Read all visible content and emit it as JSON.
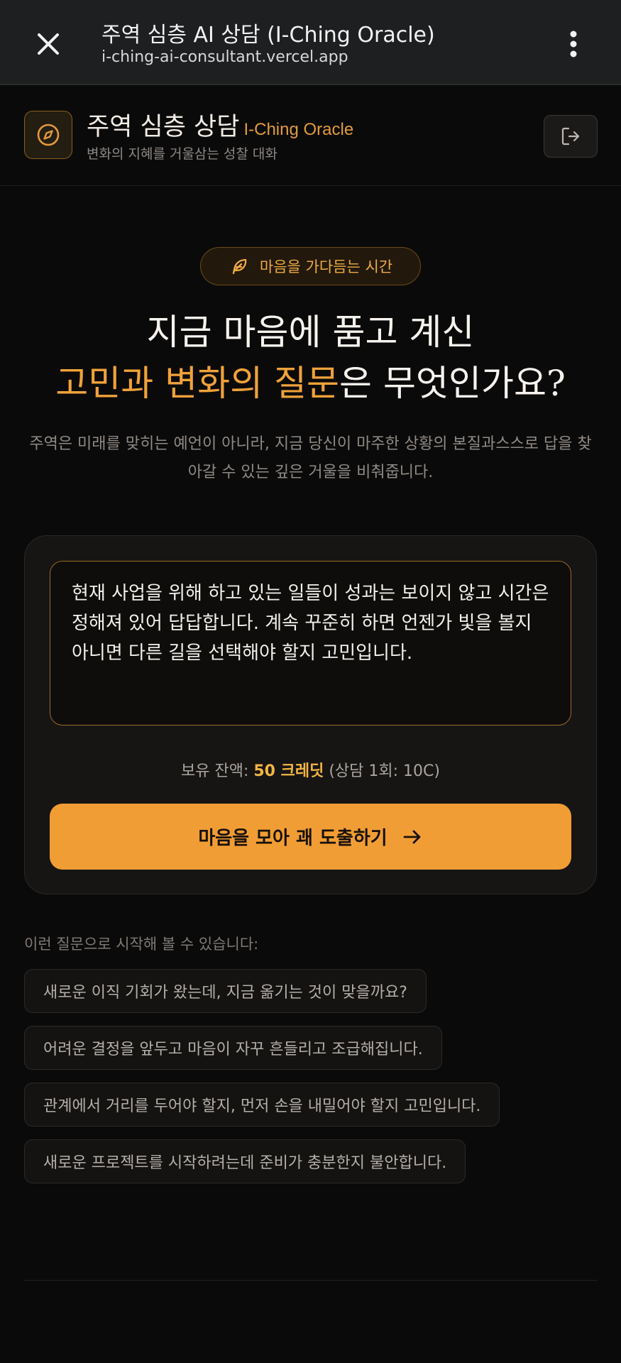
{
  "browser": {
    "page_title": "주역 심층 AI 상담 (I-Ching Oracle)",
    "url": "i-ching-ai-consultant.vercel.app",
    "close_icon": "close-icon",
    "menu_icon": "more-vertical-icon"
  },
  "header": {
    "title": "주역 심층 상담",
    "title_en": "I-Ching Oracle",
    "subtitle": "변화의 지혜를 거울삼는 성찰 대화",
    "logo_icon": "compass-icon",
    "logout_icon": "logout-icon"
  },
  "hero": {
    "badge_icon": "feather-icon",
    "badge_text": "마음을 가다듬는 시간",
    "headline_line1": "지금 마음에 품고 계신",
    "headline_accent": "고민과 변화의 질문",
    "headline_rest": "은 무엇인가요?",
    "description": "주역은 미래를 맞히는 예언이 아니라, 지금 당신이 마주한 상황의 본질과스스로 답을 찾아갈 수 있는 깊은 거울을 비춰줍니다."
  },
  "form": {
    "question_value": "현재 사업을 위해 하고 있는 일들이 성과는 보이지 않고 시간은 정해져 있어 답답합니다. 계속 꾸준히 하면 언젠가 빛을 볼지 아니면 다른 길을 선택해야 할지 고민입니다.",
    "balance_label": "보유 잔액: ",
    "balance_amount": "50 크레딧",
    "balance_cost": " (상담 1회: 10C)",
    "submit_label": "마음을 모아 괘 도출하기",
    "submit_icon": "arrow-right-icon"
  },
  "examples": {
    "label": "이런 질문으로 시작해 볼 수 있습니다:",
    "items": [
      "새로운 이직 기회가 왔는데, 지금 옮기는 것이 맞을까요?",
      "어려운 결정을 앞두고 마음이 자꾸 흔들리고 조급해집니다.",
      "관계에서 거리를 두어야 할지, 먼저 손을 내밀어야 할지 고민입니다.",
      "새로운 프로젝트를 시작하려는데 준비가 충분한지 불안합니다."
    ]
  },
  "colors": {
    "accent": "#f0a23a",
    "button": "#f19d35",
    "background": "#0b0a0a"
  }
}
